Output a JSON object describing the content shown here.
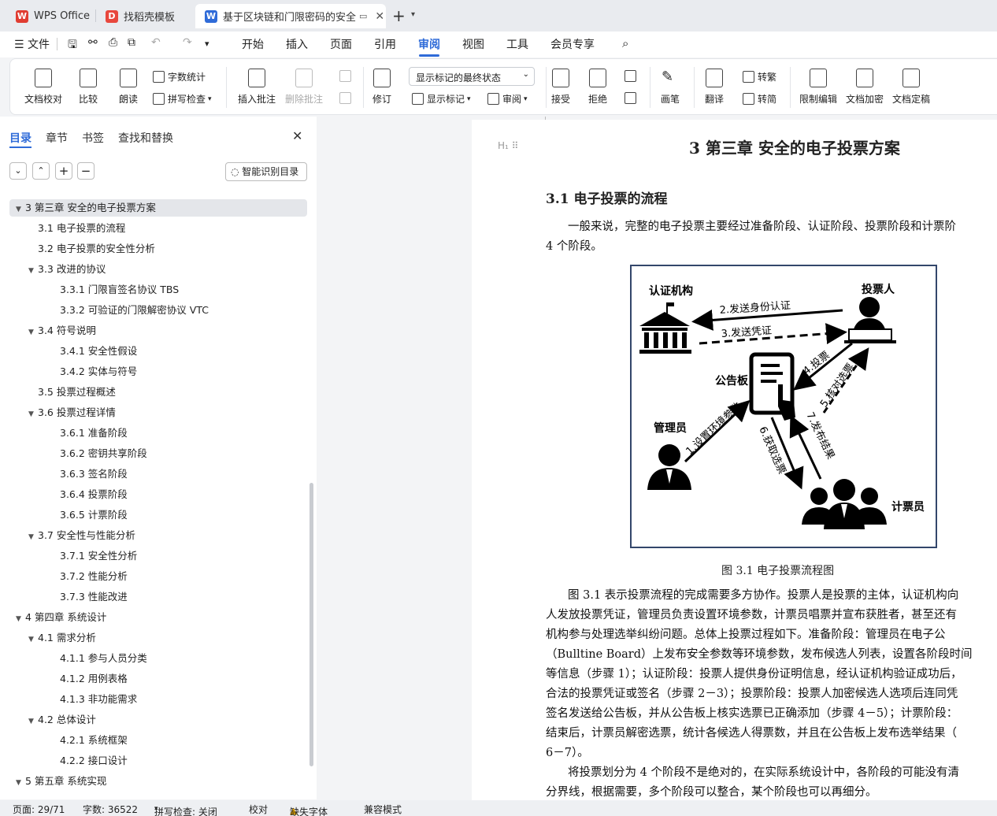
{
  "tabs": [
    {
      "label": "WPS Office"
    },
    {
      "label": "找稻壳模板"
    },
    {
      "label": "基于区块链和门限密码的安全"
    }
  ],
  "menu": [
    "文件",
    "开始",
    "插入",
    "页面",
    "引用",
    "审阅",
    "视图",
    "工具",
    "会员专享"
  ],
  "ribbon": {
    "doc_check": "文档校对",
    "compare": "比较",
    "read_aloud": "朗读",
    "word_count": "字数统计",
    "spell_check": "拼写检查",
    "insert_comment": "插入批注",
    "delete_comment": "删除批注",
    "revise": "修订",
    "display_mode": "显示标记的最终状态",
    "show_markup": "显示标记",
    "review": "审阅",
    "accept": "接受",
    "reject": "拒绝",
    "pen": "画笔",
    "translate": "翻译",
    "to_traditional": "转繁",
    "to_simplified": "转简",
    "restrict_edit": "限制编辑",
    "doc_encrypt": "文档加密",
    "doc_finalize": "文档定稿"
  },
  "panel": {
    "tabs": [
      "目录",
      "章节",
      "书签",
      "查找和替换"
    ],
    "smart_toc": "智能识别目录"
  },
  "toc": [
    {
      "label": "3  第三章   安全的电子投票方案",
      "level": 0,
      "expand": true,
      "selected": true
    },
    {
      "label": "3.1  电子投票的流程",
      "level": 1
    },
    {
      "label": "3.2  电子投票的安全性分析",
      "level": 1
    },
    {
      "label": "3.3  改进的协议",
      "level": 1,
      "expand": true
    },
    {
      "label": "3.3.1  门限盲签名协议 TBS",
      "level": 2
    },
    {
      "label": "3.3.2  可验证的门限解密协议 VTC",
      "level": 2
    },
    {
      "label": "3.4  符号说明",
      "level": 1,
      "expand": true
    },
    {
      "label": "3.4.1  安全性假设",
      "level": 2
    },
    {
      "label": "3.4.2  实体与符号",
      "level": 2
    },
    {
      "label": "3.5  投票过程概述",
      "level": 1
    },
    {
      "label": "3.6  投票过程详情",
      "level": 1,
      "expand": true
    },
    {
      "label": "3.6.1  准备阶段",
      "level": 2
    },
    {
      "label": "3.6.2  密钥共享阶段",
      "level": 2
    },
    {
      "label": "3.6.3  签名阶段",
      "level": 2
    },
    {
      "label": "3.6.4  投票阶段",
      "level": 2
    },
    {
      "label": "3.6.5  计票阶段",
      "level": 2
    },
    {
      "label": "3.7  安全性与性能分析",
      "level": 1,
      "expand": true
    },
    {
      "label": "3.7.1  安全性分析",
      "level": 2
    },
    {
      "label": "3.7.2  性能分析",
      "level": 2
    },
    {
      "label": "3.7.3  性能改进",
      "level": 2
    },
    {
      "label": "4  第四章   系统设计",
      "level": 0,
      "expand": true
    },
    {
      "label": "4.1  需求分析",
      "level": 1,
      "expand": true
    },
    {
      "label": "4.1.1  参与人员分类",
      "level": 2
    },
    {
      "label": "4.1.2  用例表格",
      "level": 2
    },
    {
      "label": "4.1.3  非功能需求",
      "level": 2
    },
    {
      "label": "4.2  总体设计",
      "level": 1,
      "expand": true
    },
    {
      "label": "4.2.1  系统框架",
      "level": 2
    },
    {
      "label": "4.2.2  接口设计",
      "level": 2
    },
    {
      "label": "5  第五章   系统实现",
      "level": 0,
      "expand": true
    }
  ],
  "doc": {
    "chapter": "3  第三章   安全的电子投票方案",
    "section": "3.1  电子投票的流程",
    "intro": [
      "一般来说，完整的电子投票主要经过准备阶段、认证阶段、投票阶段和计票阶",
      "4 个阶段。"
    ],
    "figure": {
      "ca": "认证机构",
      "voter": "投票人",
      "board": "公告板",
      "admin": "管理员",
      "teller": "计票员",
      "s1": "1.设置环境参数",
      "s2": "2.发送身份认证",
      "s3": "3.发送凭证",
      "s4": "4.投票",
      "s5": "5.核对选票",
      "s6": "6.获取选票",
      "s7": "7.发布结果"
    },
    "caption": "图 3.1 电子投票流程图",
    "body": [
      "图 3.1 表示投票流程的完成需要多方协作。投票人是投票的主体，认证机构向",
      "人发放投票凭证，管理员负责设置环境参数，计票员唱票并宣布获胜者，甚至还有",
      "机构参与处理选举纠纷问题。总体上投票过程如下。准备阶段：管理员在电子公",
      "（Bulltine Board）上发布安全参数等环境参数，发布候选人列表，设置各阶段时间",
      "等信息（步骤 1）；认证阶段：投票人提供身份证明信息，经认证机构验证成功后，",
      "合法的投票凭证或签名（步骤 2－3）；投票阶段：投票人加密候选人选项后连同凭",
      "签名发送给公告板，并从公告板上核实选票已正确添加（步骤 4－5）；计票阶段：",
      "结束后，计票员解密选票，统计各候选人得票数，并且在公告板上发布选举结果（",
      "6－7）。",
      "将投票划分为 4 个阶段不是绝对的，在实际系统设计中，各阶段的可能没有清",
      "分界线，根据需要，多个阶段可以整合，某个阶段也可以再细分。"
    ]
  },
  "status": {
    "page": "页面: 29/71",
    "words": "字数: 36522",
    "spell": "拼写检查: 关闭",
    "proof": "校对",
    "missing_font": "缺失字体",
    "compat": "兼容模式"
  }
}
